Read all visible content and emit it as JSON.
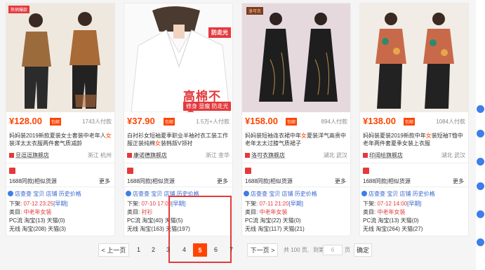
{
  "products": [
    {
      "tag": "热销爆款",
      "price": "¥128.00",
      "badge": "包邮",
      "sold": "1743人付款",
      "title_parts": [
        "妈妈装2019新款夏装女士套装中老年人",
        "女",
        "装洋太太衣服两件套气质减龄"
      ],
      "shop": "旦逗逗旗舰店",
      "location": "浙江 杭州",
      "source": "1688同款|相似货源",
      "more": "更多",
      "links": [
        "店查查",
        "宝贝",
        "店铺",
        "历史价格"
      ],
      "listed": "07-12 23:25",
      "listed_flag": "[早期]",
      "category": "中老年女装",
      "pc_key": "PC流",
      "pc": "淘宝(13)  天猫(0)",
      "wx_key": "无线",
      "wx": "淘宝(208)  天猫(3)"
    },
    {
      "tag": "",
      "price": "¥37.90",
      "badge": "包邮",
      "sold": "1.5万+人付款",
      "title_parts": [
        "白衬衫女短袖夏季职业半袖衬衣工装工作服正装纯棉",
        "女",
        "装韩版V领衬"
      ],
      "shop": "康诺德旗舰店",
      "location": "浙江 金华",
      "source": "1688同款|相似货源",
      "more": "更多",
      "links": [
        "店查查",
        "宝贝",
        "店铺",
        "历史价格"
      ],
      "listed": "07-10 17:00",
      "listed_flag": "[早期]",
      "category": "衬衫",
      "pc_key": "PC流",
      "pc": "淘宝(40)  天猫(5)",
      "wx_key": "无线",
      "wx": "淘宝(163)  天猫(197)",
      "promo_tr": "防走光",
      "promo_big": "高棉不透",
      "promo_sub": "修身 显瘦 防走光"
    },
    {
      "tag": "洛可衣",
      "price": "¥158.00",
      "badge": "包邮",
      "sold": "894人付款",
      "title_parts": [
        "妈妈装短袖连衣裙中年",
        "女",
        "夏装洋气高贵中老年太太过膝气质裙子"
      ],
      "shop": "洛可衣旗舰店",
      "location": "湖北 武汉",
      "source": "1688同款|相似货源",
      "more": "更多",
      "links": [
        "店查查",
        "宝贝",
        "店铺",
        "历史价格"
      ],
      "listed": "07-11 21:20",
      "listed_flag": "[早期]",
      "category": "中老年女装",
      "pc_key": "PC流",
      "pc": "淘宝(22)  天猫(0)",
      "wx_key": "无线",
      "wx": "淘宝(117)  天猫(21)"
    },
    {
      "tag": "",
      "price": "¥138.00",
      "badge": "包邮",
      "sold": "1084人付款",
      "title_parts": [
        "妈妈装夏装2019新款中年",
        "女",
        "装短袖T恤中老年两件套夏季女装上衣服"
      ],
      "shop": "印阔绘旗舰店",
      "location": "湖北 武汉",
      "source": "1688同款|相似货源",
      "more": "更多",
      "links": [
        "店查查",
        "宝贝",
        "店铺",
        "历史价格"
      ],
      "listed": "07-12 14:00",
      "listed_flag": "[早期]",
      "category": "中老年女装",
      "pc_key": "PC流",
      "pc": "淘宝(13)  天猫(0)",
      "wx_key": "无线",
      "wx": "淘宝(264)  天猫(27)"
    }
  ],
  "labels": {
    "listed": "下架:",
    "category": "类目:"
  },
  "pagination": {
    "prev": "< 上一页",
    "pages": [
      "1",
      "2",
      "3",
      "4",
      "5",
      "6",
      "7"
    ],
    "active": "5",
    "next": "下一页 >",
    "total": "共 100 页,",
    "goto": "到第",
    "page_input": "6",
    "unit": "页",
    "confirm": "确定"
  }
}
